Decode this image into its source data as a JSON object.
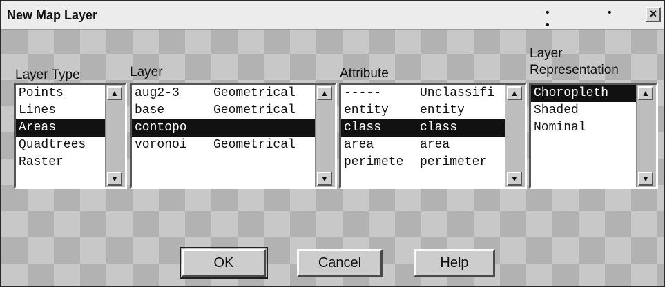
{
  "window": {
    "title": "New Map Layer",
    "close_glyph": "×",
    "dots": "• • •"
  },
  "labels": {
    "layer_type": "Layer Type",
    "layer": "Layer",
    "attribute": "Attribute",
    "representation_line1": "Layer",
    "representation_line2": "Representation"
  },
  "layer_type_list": {
    "items": [
      "Points",
      "Lines",
      "Areas",
      "Quadtrees",
      "Raster"
    ],
    "selected": "Areas"
  },
  "layer_list": {
    "items": [
      {
        "name": "aug2-3",
        "type": "Geometrical"
      },
      {
        "name": "base",
        "type": "Geometrical"
      },
      {
        "name": "contopo",
        "type": ""
      },
      {
        "name": "voronoi",
        "type": "Geometrical"
      }
    ],
    "selected": "contopo"
  },
  "attribute_list": {
    "items": [
      {
        "name": "-----",
        "value": "Unclassifi"
      },
      {
        "name": "entity",
        "value": "entity"
      },
      {
        "name": "class",
        "value": "class"
      },
      {
        "name": "area",
        "value": "area"
      },
      {
        "name": "perimete",
        "value": "perimeter"
      }
    ],
    "selected": "class"
  },
  "representation_list": {
    "items": [
      "Choropleth",
      "Shaded",
      "Nominal"
    ],
    "selected": "Choropleth"
  },
  "buttons": {
    "ok": "OK",
    "cancel": "Cancel",
    "help": "Help"
  },
  "icons": {
    "scroll_up": "up-arrow-icon",
    "scroll_down": "down-arrow-icon"
  }
}
